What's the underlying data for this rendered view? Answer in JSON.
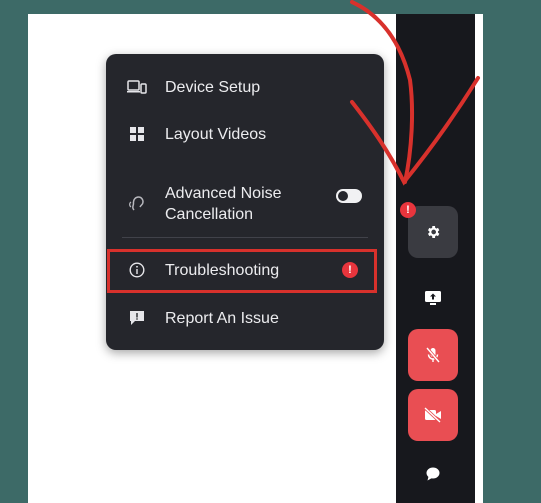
{
  "menu": {
    "items": [
      {
        "label": "Device Setup",
        "icon": "device-setup-icon"
      },
      {
        "label": "Layout Videos",
        "icon": "layout-grid-icon"
      },
      {
        "label": "Advanced Noise Cancellation",
        "icon": "ear-icon",
        "toggle": "on"
      },
      {
        "label": "Troubleshooting",
        "icon": "info-circle-icon",
        "alert": "!"
      },
      {
        "label": "Report An Issue",
        "icon": "report-issue-icon"
      }
    ]
  },
  "toolbar": {
    "settings_alert": "!",
    "buttons": [
      "gear-icon",
      "screen-share-icon",
      "mic-muted-icon",
      "camera-off-icon",
      "chat-icon"
    ]
  },
  "colors": {
    "background": "#3d6a67",
    "toolbar": "#17181d",
    "menu": "#25262c",
    "alert": "#e8353d",
    "muted_button": "#e94e53",
    "annotation": "#d8312c"
  }
}
